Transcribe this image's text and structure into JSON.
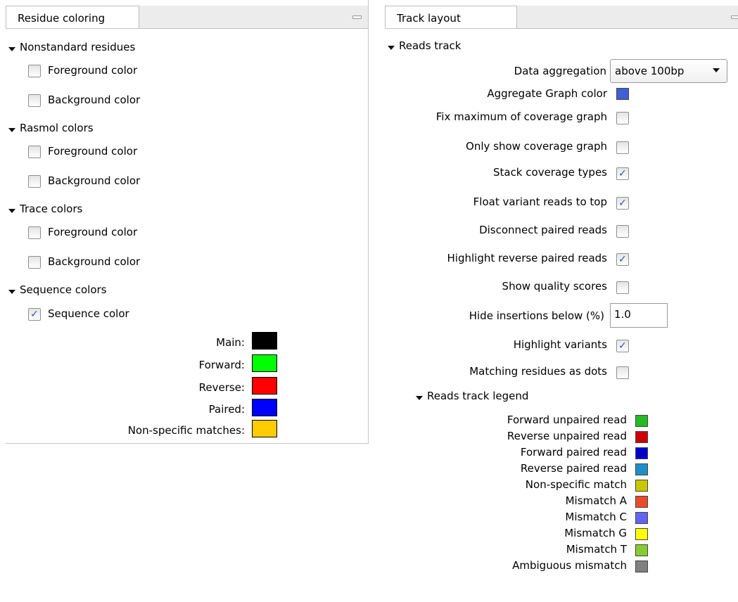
{
  "residue_panel": {
    "tab_label": "Residue coloring",
    "sections": [
      {
        "title": "Nonstandard residues",
        "options": [
          {
            "label": "Foreground color",
            "checked": false
          },
          {
            "label": "Background color",
            "checked": false
          }
        ]
      },
      {
        "title": "Rasmol colors",
        "options": [
          {
            "label": "Foreground color",
            "checked": false
          },
          {
            "label": "Background color",
            "checked": false
          }
        ]
      },
      {
        "title": "Trace colors",
        "options": [
          {
            "label": "Foreground color",
            "checked": false
          },
          {
            "label": "Background color",
            "checked": false
          }
        ]
      },
      {
        "title": "Sequence colors",
        "options": [
          {
            "label": "Sequence color",
            "checked": true
          }
        ]
      }
    ],
    "sequence_swatches": [
      {
        "label": "Main:",
        "color": "#000000"
      },
      {
        "label": "Forward:",
        "color": "#00ff00"
      },
      {
        "label": "Reverse:",
        "color": "#ff0000"
      },
      {
        "label": "Paired:",
        "color": "#0000ff"
      },
      {
        "label": "Non-specific matches:",
        "color": "#ffcc00"
      }
    ]
  },
  "track_panel": {
    "tab_label": "Track layout",
    "section_title": "Reads track",
    "data_aggregation": {
      "label": "Data aggregation",
      "value": "above 100bp"
    },
    "aggregate_graph_color": {
      "label": "Aggregate Graph color",
      "color": "#3f5fd6"
    },
    "options": [
      {
        "label": "Fix maximum of coverage graph",
        "checked": false
      },
      {
        "label": "Only show coverage graph",
        "checked": false
      },
      {
        "label": "Stack coverage types",
        "checked": true
      },
      {
        "label": "Float variant reads to top",
        "checked": true
      },
      {
        "label": "Disconnect paired reads",
        "checked": false
      },
      {
        "label": "Highlight reverse paired reads",
        "checked": true
      },
      {
        "label": "Show quality scores",
        "checked": false
      }
    ],
    "hide_insertions": {
      "label": "Hide insertions below (%)",
      "value": "1.0"
    },
    "options2": [
      {
        "label": "Highlight variants",
        "checked": true
      },
      {
        "label": "Matching residues as dots",
        "checked": false
      }
    ],
    "legend_title": "Reads track legend",
    "legend": [
      {
        "label": "Forward unpaired read",
        "color": "#22bb22"
      },
      {
        "label": "Reverse unpaired read",
        "color": "#cc0000"
      },
      {
        "label": "Forward paired read",
        "color": "#0000cc"
      },
      {
        "label": "Reverse paired read",
        "color": "#1e90c8"
      },
      {
        "label": "Non-specific match",
        "color": "#c8c800"
      },
      {
        "label": "Mismatch A",
        "color": "#e84a2a"
      },
      {
        "label": "Mismatch C",
        "color": "#6464f0"
      },
      {
        "label": "Mismatch G",
        "color": "#ffff00"
      },
      {
        "label": "Mismatch T",
        "color": "#88cc33"
      },
      {
        "label": "Ambiguous mismatch",
        "color": "#808080"
      }
    ]
  }
}
